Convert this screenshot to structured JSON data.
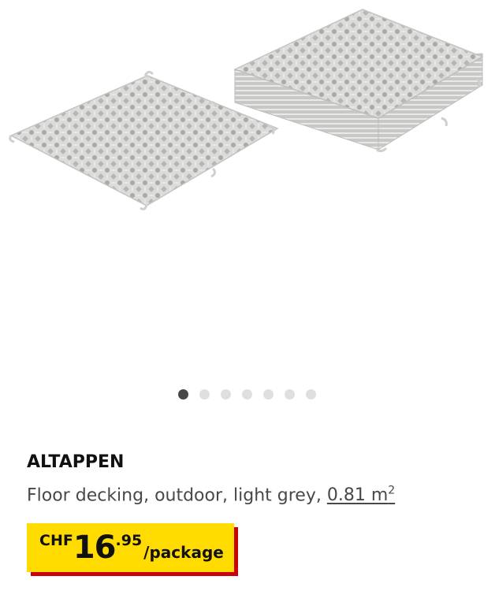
{
  "gallery": {
    "image_alt": "ALTAPPEN floor decking tiles",
    "dot_count": 7,
    "active_index": 0
  },
  "product": {
    "name": "ALTAPPEN",
    "description": "Floor decking, outdoor, light grey, ",
    "measure_value": "0.81 m",
    "measure_sup": "2"
  },
  "price": {
    "currency": "CHF",
    "integer": "16",
    "decimals": ".95",
    "unit": "/package"
  },
  "colors": {
    "price_bg": "#ffdb00",
    "price_shadow": "#cc0008",
    "tile": "#d9d9d7"
  }
}
